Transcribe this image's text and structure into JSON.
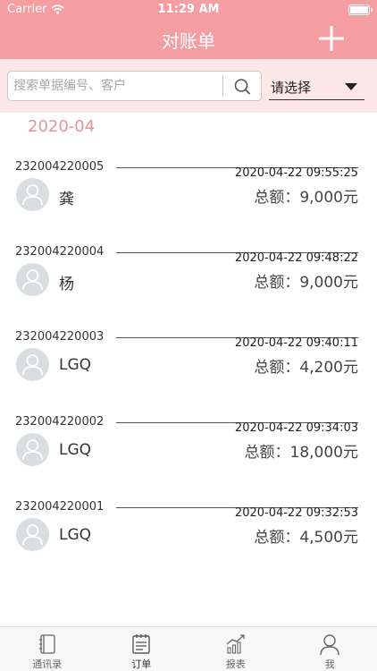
{
  "status_bar": {
    "carrier": "Carrier",
    "time": "11:29 AM"
  },
  "nav": {
    "title": "对账单",
    "add_icon": "plus-icon"
  },
  "search": {
    "placeholder": "搜索单据编号、客户",
    "value": "",
    "select_label": "请选择"
  },
  "month": "2020-04",
  "orders": [
    {
      "no": "232004220005",
      "name": "龚",
      "datetime": "2020-04-22 09:55:25",
      "total_label": "总额：",
      "amount": "9,000元"
    },
    {
      "no": "232004220004",
      "name": "杨",
      "datetime": "2020-04-22 09:48:22",
      "total_label": "总额：",
      "amount": "9,000元"
    },
    {
      "no": "232004220003",
      "name": "LGQ",
      "datetime": "2020-04-22 09:40:11",
      "total_label": "总额：",
      "amount": "4,200元"
    },
    {
      "no": "232004220002",
      "name": "LGQ",
      "datetime": "2020-04-22 09:34:03",
      "total_label": "总额：",
      "amount": "18,000元"
    },
    {
      "no": "232004220001",
      "name": "LGQ",
      "datetime": "2020-04-22 09:32:53",
      "total_label": "总额：",
      "amount": "4,500元"
    }
  ],
  "tabs": [
    {
      "label": "通讯录",
      "icon": "contacts-book-icon"
    },
    {
      "label": "订单",
      "icon": "order-list-icon",
      "active": true
    },
    {
      "label": "报表",
      "icon": "report-chart-icon"
    },
    {
      "label": "我",
      "icon": "person-icon"
    }
  ],
  "colors": {
    "primary": "#f59ea1",
    "search_bg": "#fde6e6",
    "month_text": "#e59598",
    "avatar_bg": "#d9dee0"
  }
}
